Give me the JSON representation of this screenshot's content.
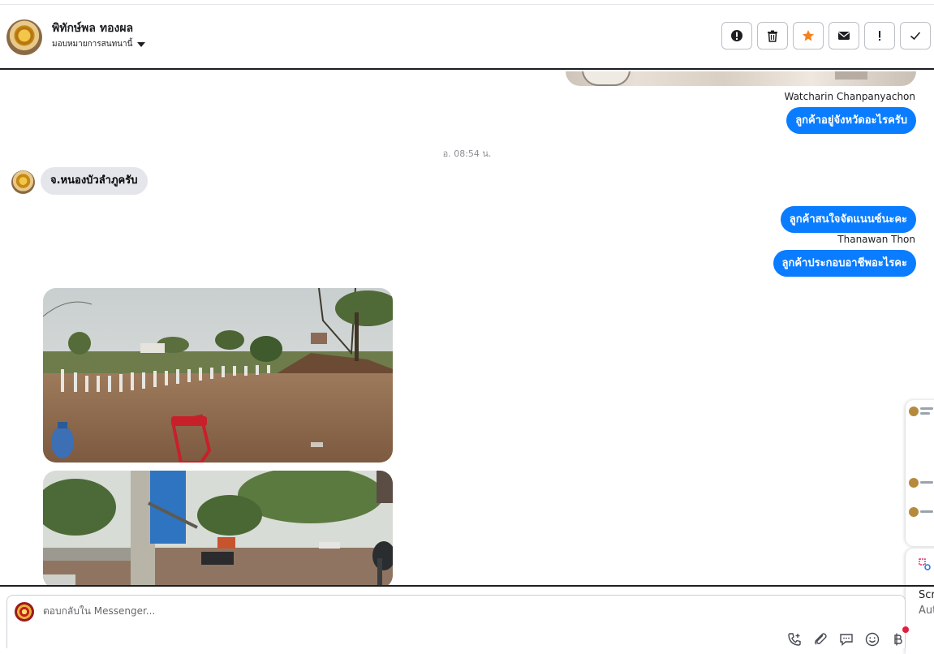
{
  "header": {
    "contact_name": "พิทักษ์พล ทองผล",
    "assign_label": "มอบหมายการสนทนานี้",
    "actions": [
      {
        "name": "report-button",
        "icon": "exclamation-circle-icon"
      },
      {
        "name": "delete-button",
        "icon": "trash-icon"
      },
      {
        "name": "star-button",
        "icon": "star-icon"
      },
      {
        "name": "mark-unread-button",
        "icon": "envelope-icon"
      },
      {
        "name": "follow-up-button",
        "icon": "exclamation-icon"
      },
      {
        "name": "done-button",
        "icon": "check-icon"
      }
    ]
  },
  "messages": [
    {
      "type": "sender",
      "text": "Watcharin Chanpanyachon"
    },
    {
      "type": "outgoing",
      "text": "ลูกค้าอยู่จังหวัดอะไรครับ"
    },
    {
      "type": "timestamp",
      "text": "อ. 08:54 น."
    },
    {
      "type": "incoming",
      "text": "จ.หนองบัวลำภูครับ"
    },
    {
      "type": "outgoing",
      "text": "ลูกค้าสนใจจัดแนนซ์นะคะ"
    },
    {
      "type": "sender",
      "text": "Thanawan Thon"
    },
    {
      "type": "outgoing",
      "text": "ลูกค้าประกอบอาชีพอะไรคะ"
    }
  ],
  "side_card": {
    "title": "Scr",
    "subtitle": "Aut"
  },
  "composer": {
    "placeholder": "ตอบกลับใน Messenger..."
  },
  "tools": [
    {
      "name": "call-button",
      "icon": "phone-plus-icon"
    },
    {
      "name": "attach-button",
      "icon": "paperclip-icon"
    },
    {
      "name": "saved-replies-button",
      "icon": "speech-bubble-icon"
    },
    {
      "name": "emoji-button",
      "icon": "smiley-icon"
    },
    {
      "name": "payment-button",
      "icon": "baht-icon"
    }
  ],
  "colors": {
    "outgoing_bubble": "#0a7cff",
    "incoming_bubble": "#e4e6eb",
    "star": "#f5821f"
  }
}
